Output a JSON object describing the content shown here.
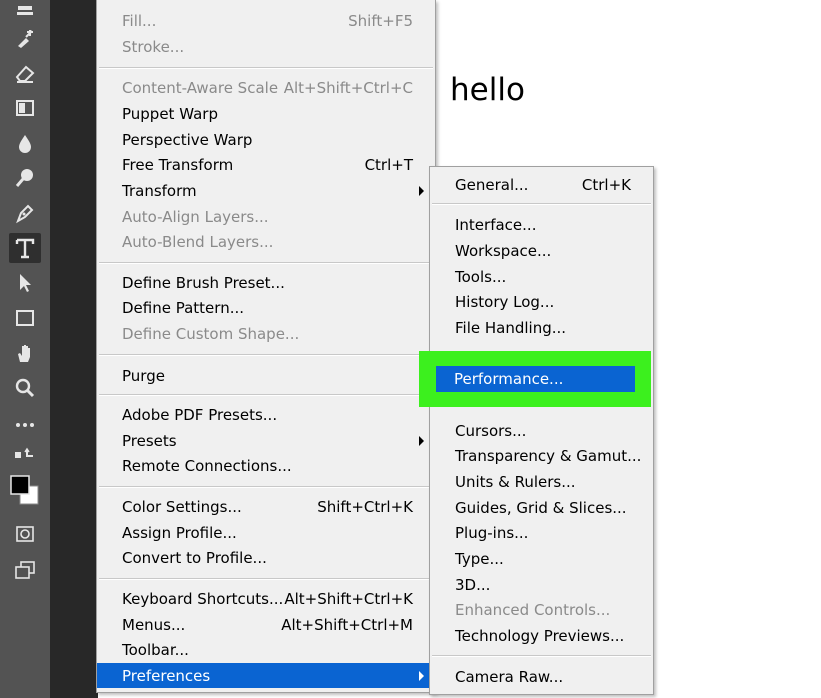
{
  "canvas": {
    "text": "hello"
  },
  "edit_menu": {
    "items": [
      {
        "label": "Fill...",
        "shortcut": "Shift+F5",
        "disabled": true
      },
      {
        "label": "Stroke...",
        "shortcut": "",
        "disabled": true
      },
      {
        "label": "Content-Aware Scale",
        "shortcut": "Alt+Shift+Ctrl+C",
        "disabled": true
      },
      {
        "label": "Puppet Warp",
        "shortcut": "",
        "disabled": false
      },
      {
        "label": "Perspective Warp",
        "shortcut": "",
        "disabled": false
      },
      {
        "label": "Free Transform",
        "shortcut": "Ctrl+T",
        "disabled": false
      },
      {
        "label": "Transform",
        "shortcut": "",
        "disabled": false
      },
      {
        "label": "Auto-Align Layers...",
        "shortcut": "",
        "disabled": true
      },
      {
        "label": "Auto-Blend Layers...",
        "shortcut": "",
        "disabled": true
      },
      {
        "label": "Define Brush Preset...",
        "shortcut": "",
        "disabled": false
      },
      {
        "label": "Define Pattern...",
        "shortcut": "",
        "disabled": false
      },
      {
        "label": "Define Custom Shape...",
        "shortcut": "",
        "disabled": true
      },
      {
        "label": "Purge",
        "shortcut": "",
        "disabled": false
      },
      {
        "label": "Adobe PDF Presets...",
        "shortcut": "",
        "disabled": false
      },
      {
        "label": "Presets",
        "shortcut": "",
        "disabled": false
      },
      {
        "label": "Remote Connections...",
        "shortcut": "",
        "disabled": false
      },
      {
        "label": "Color Settings...",
        "shortcut": "Shift+Ctrl+K",
        "disabled": false
      },
      {
        "label": "Assign Profile...",
        "shortcut": "",
        "disabled": false
      },
      {
        "label": "Convert to Profile...",
        "shortcut": "",
        "disabled": false
      },
      {
        "label": "Keyboard Shortcuts...",
        "shortcut": "Alt+Shift+Ctrl+K",
        "disabled": false
      },
      {
        "label": "Menus...",
        "shortcut": "Alt+Shift+Ctrl+M",
        "disabled": false
      },
      {
        "label": "Toolbar...",
        "shortcut": "",
        "disabled": false
      },
      {
        "label": "Preferences",
        "shortcut": "",
        "disabled": false
      }
    ]
  },
  "pref_menu": {
    "items": [
      {
        "label": "General...",
        "shortcut": "Ctrl+K",
        "disabled": false
      },
      {
        "label": "Interface...",
        "shortcut": "",
        "disabled": false
      },
      {
        "label": "Workspace...",
        "shortcut": "",
        "disabled": false
      },
      {
        "label": "Tools...",
        "shortcut": "",
        "disabled": false
      },
      {
        "label": "History Log...",
        "shortcut": "",
        "disabled": false
      },
      {
        "label": "File Handling...",
        "shortcut": "",
        "disabled": false
      },
      {
        "label": "Performance...",
        "shortcut": "",
        "disabled": false
      },
      {
        "label": "Cursors...",
        "shortcut": "",
        "disabled": false
      },
      {
        "label": "Transparency & Gamut...",
        "shortcut": "",
        "disabled": false
      },
      {
        "label": "Units & Rulers...",
        "shortcut": "",
        "disabled": false
      },
      {
        "label": "Guides, Grid & Slices...",
        "shortcut": "",
        "disabled": false
      },
      {
        "label": "Plug-ins...",
        "shortcut": "",
        "disabled": false
      },
      {
        "label": "Type...",
        "shortcut": "",
        "disabled": false
      },
      {
        "label": "3D...",
        "shortcut": "",
        "disabled": false
      },
      {
        "label": "Enhanced Controls...",
        "shortcut": "",
        "disabled": true
      },
      {
        "label": "Technology Previews...",
        "shortcut": "",
        "disabled": false
      },
      {
        "label": "Camera Raw...",
        "shortcut": "",
        "disabled": false
      }
    ]
  },
  "colors": {
    "highlight": "#0a64d2",
    "callout_green": "#3cf01e",
    "toolbar": "#535353"
  },
  "tools": [
    "stamp-icon",
    "history-brush-icon",
    "eraser-icon",
    "gradient-icon",
    "blur-icon",
    "dodge-icon",
    "pen-icon",
    "type-icon",
    "path-select-icon",
    "rectangle-icon",
    "hand-icon",
    "zoom-icon",
    "more-icon",
    "swap-colors-icon",
    "color-swatches-icon",
    "quick-mask-icon",
    "screen-mode-icon"
  ]
}
